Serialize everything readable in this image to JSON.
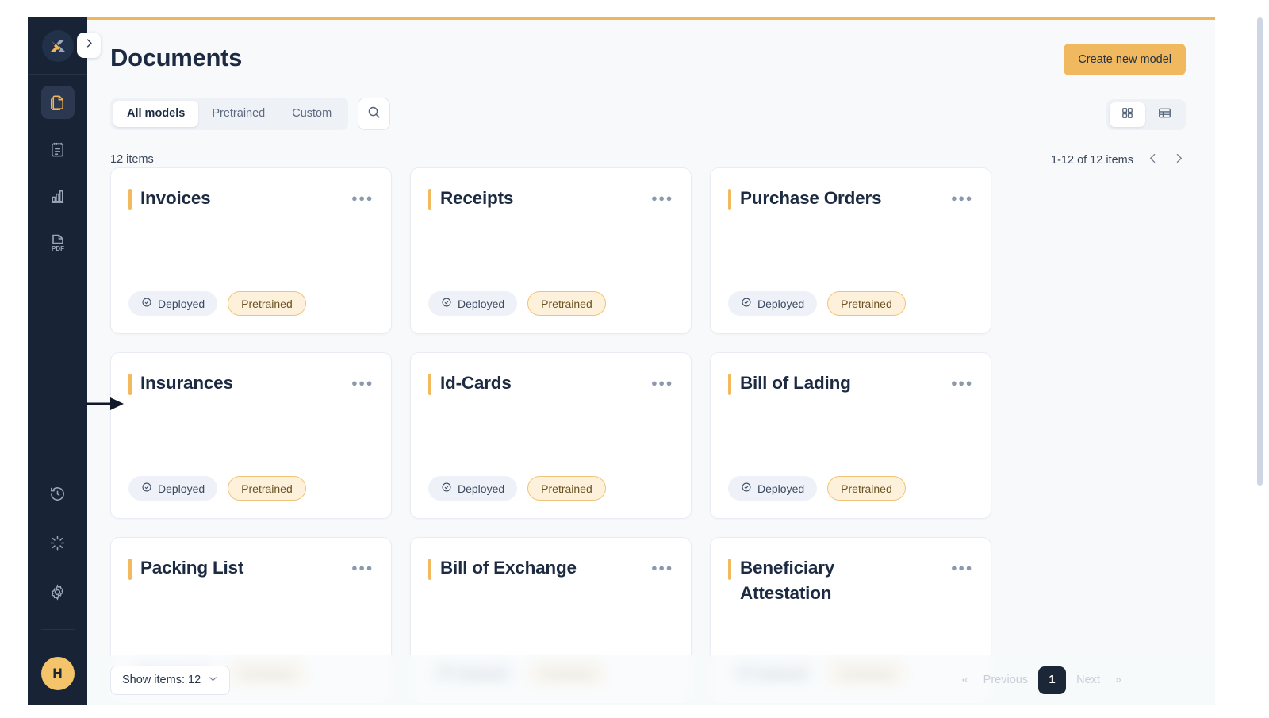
{
  "brand": {
    "logo_icon": "x-logo-icon",
    "accent_color": "#f0b758",
    "sidebar_bg": "#182436"
  },
  "sidebar": {
    "items": [
      {
        "icon": "documents-icon",
        "label": "Documents",
        "active": true
      },
      {
        "icon": "clipboard-icon",
        "label": "Tasks",
        "active": false
      },
      {
        "icon": "bar-chart-icon",
        "label": "Analytics",
        "active": false
      },
      {
        "icon": "pdf-file-icon",
        "label": "PDF",
        "active": false
      }
    ],
    "bottom_items": [
      {
        "icon": "history-icon",
        "label": "History"
      },
      {
        "icon": "loading-spinner-icon",
        "label": "Processing"
      },
      {
        "icon": "gear-icon",
        "label": "Settings"
      }
    ],
    "avatar": {
      "initial": "H",
      "color": "#f4c46a"
    },
    "collapse_toggle_icon": "chevron-right-icon"
  },
  "header": {
    "title": "Documents",
    "create_button": "Create new model"
  },
  "filters": {
    "tabs": [
      {
        "label": "All models",
        "active": true
      },
      {
        "label": "Pretrained",
        "active": false
      },
      {
        "label": "Custom",
        "active": false
      }
    ],
    "search_icon": "search-icon"
  },
  "view_toggle": {
    "grid_icon": "grid-view-icon",
    "table_icon": "table-view-icon",
    "active": "grid"
  },
  "list_meta": {
    "items_count": "12 items",
    "range": "1-12 of 12 items",
    "prev_icon": "chevron-left-icon",
    "next_icon": "chevron-right-icon"
  },
  "badges": {
    "deployed": "Deployed",
    "pretrained": "Pretrained",
    "deployed_icon": "check-circle-icon"
  },
  "cards": [
    {
      "title": "Invoices",
      "deployed": "Deployed",
      "pretrained": "Pretrained",
      "menu_icon": "more-options-icon"
    },
    {
      "title": "Receipts",
      "deployed": "Deployed",
      "pretrained": "Pretrained",
      "menu_icon": "more-options-icon"
    },
    {
      "title": "Purchase Orders",
      "deployed": "Deployed",
      "pretrained": "Pretrained",
      "menu_icon": "more-options-icon"
    },
    {
      "title": "Insurances",
      "deployed": "Deployed",
      "pretrained": "Pretrained",
      "menu_icon": "more-options-icon"
    },
    {
      "title": "Id-Cards",
      "deployed": "Deployed",
      "pretrained": "Pretrained",
      "menu_icon": "more-options-icon"
    },
    {
      "title": "Bill of Lading",
      "deployed": "Deployed",
      "pretrained": "Pretrained",
      "menu_icon": "more-options-icon"
    },
    {
      "title": "Packing List",
      "deployed": "Deployed",
      "pretrained": "Pretrained",
      "menu_icon": "more-options-icon"
    },
    {
      "title": "Bill of Exchange",
      "deployed": "Deployed",
      "pretrained": "Pretrained",
      "menu_icon": "more-options-icon"
    },
    {
      "title": "Beneficiary Attestation",
      "deployed": "Deployed",
      "pretrained": "Pretrained",
      "menu_icon": "more-options-icon"
    }
  ],
  "footer": {
    "show_items_label": "Show items: 12",
    "chevron_icon": "chevron-down-icon",
    "first_symbol": "«",
    "previous": "Previous",
    "current_page": "1",
    "next": "Next",
    "last_symbol": "»"
  },
  "annotation": {
    "arrow_icon": "pointer-arrow-icon"
  }
}
